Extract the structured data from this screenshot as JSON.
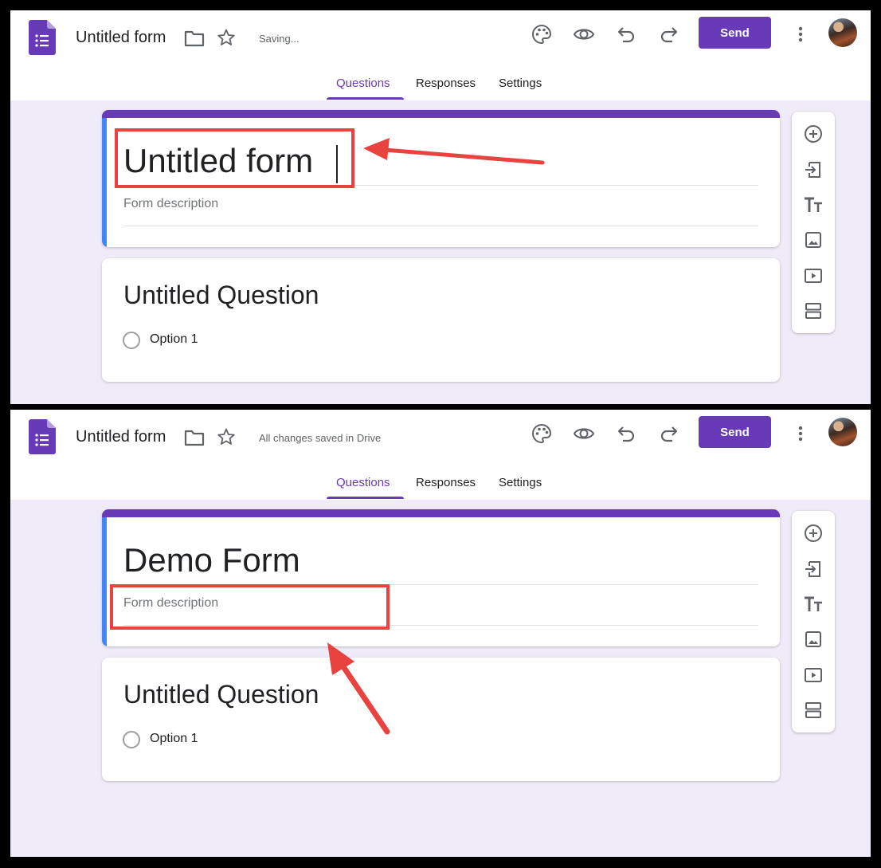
{
  "panels": [
    {
      "doc_title": "Untitled form",
      "save_status": "Saving...",
      "send_label": "Send",
      "tabs": [
        "Questions",
        "Responses",
        "Settings"
      ],
      "form_title": "Untitled form",
      "form_description_placeholder": "Form description",
      "question_title": "Untitled Question",
      "option_label": "Option 1"
    },
    {
      "doc_title": "Untitled form",
      "save_status": "All changes saved in Drive",
      "send_label": "Send",
      "tabs": [
        "Questions",
        "Responses",
        "Settings"
      ],
      "form_title": "Demo Form",
      "form_description_placeholder": "Form description",
      "question_title": "Untitled Question",
      "option_label": "Option 1"
    }
  ],
  "icons": {
    "header": [
      "forms-logo-icon",
      "folder-icon",
      "star-icon",
      "palette-icon",
      "eye-icon",
      "undo-icon",
      "redo-icon",
      "more-vert-icon"
    ],
    "toolbar": [
      "add-question-icon",
      "import-questions-icon",
      "add-title-icon",
      "add-image-icon",
      "add-video-icon",
      "add-section-icon"
    ]
  },
  "colors": {
    "accent": "#673ab7",
    "background": "#f0ebf8",
    "annotation": "#e8433f",
    "active_card_border": "#4285f4"
  }
}
